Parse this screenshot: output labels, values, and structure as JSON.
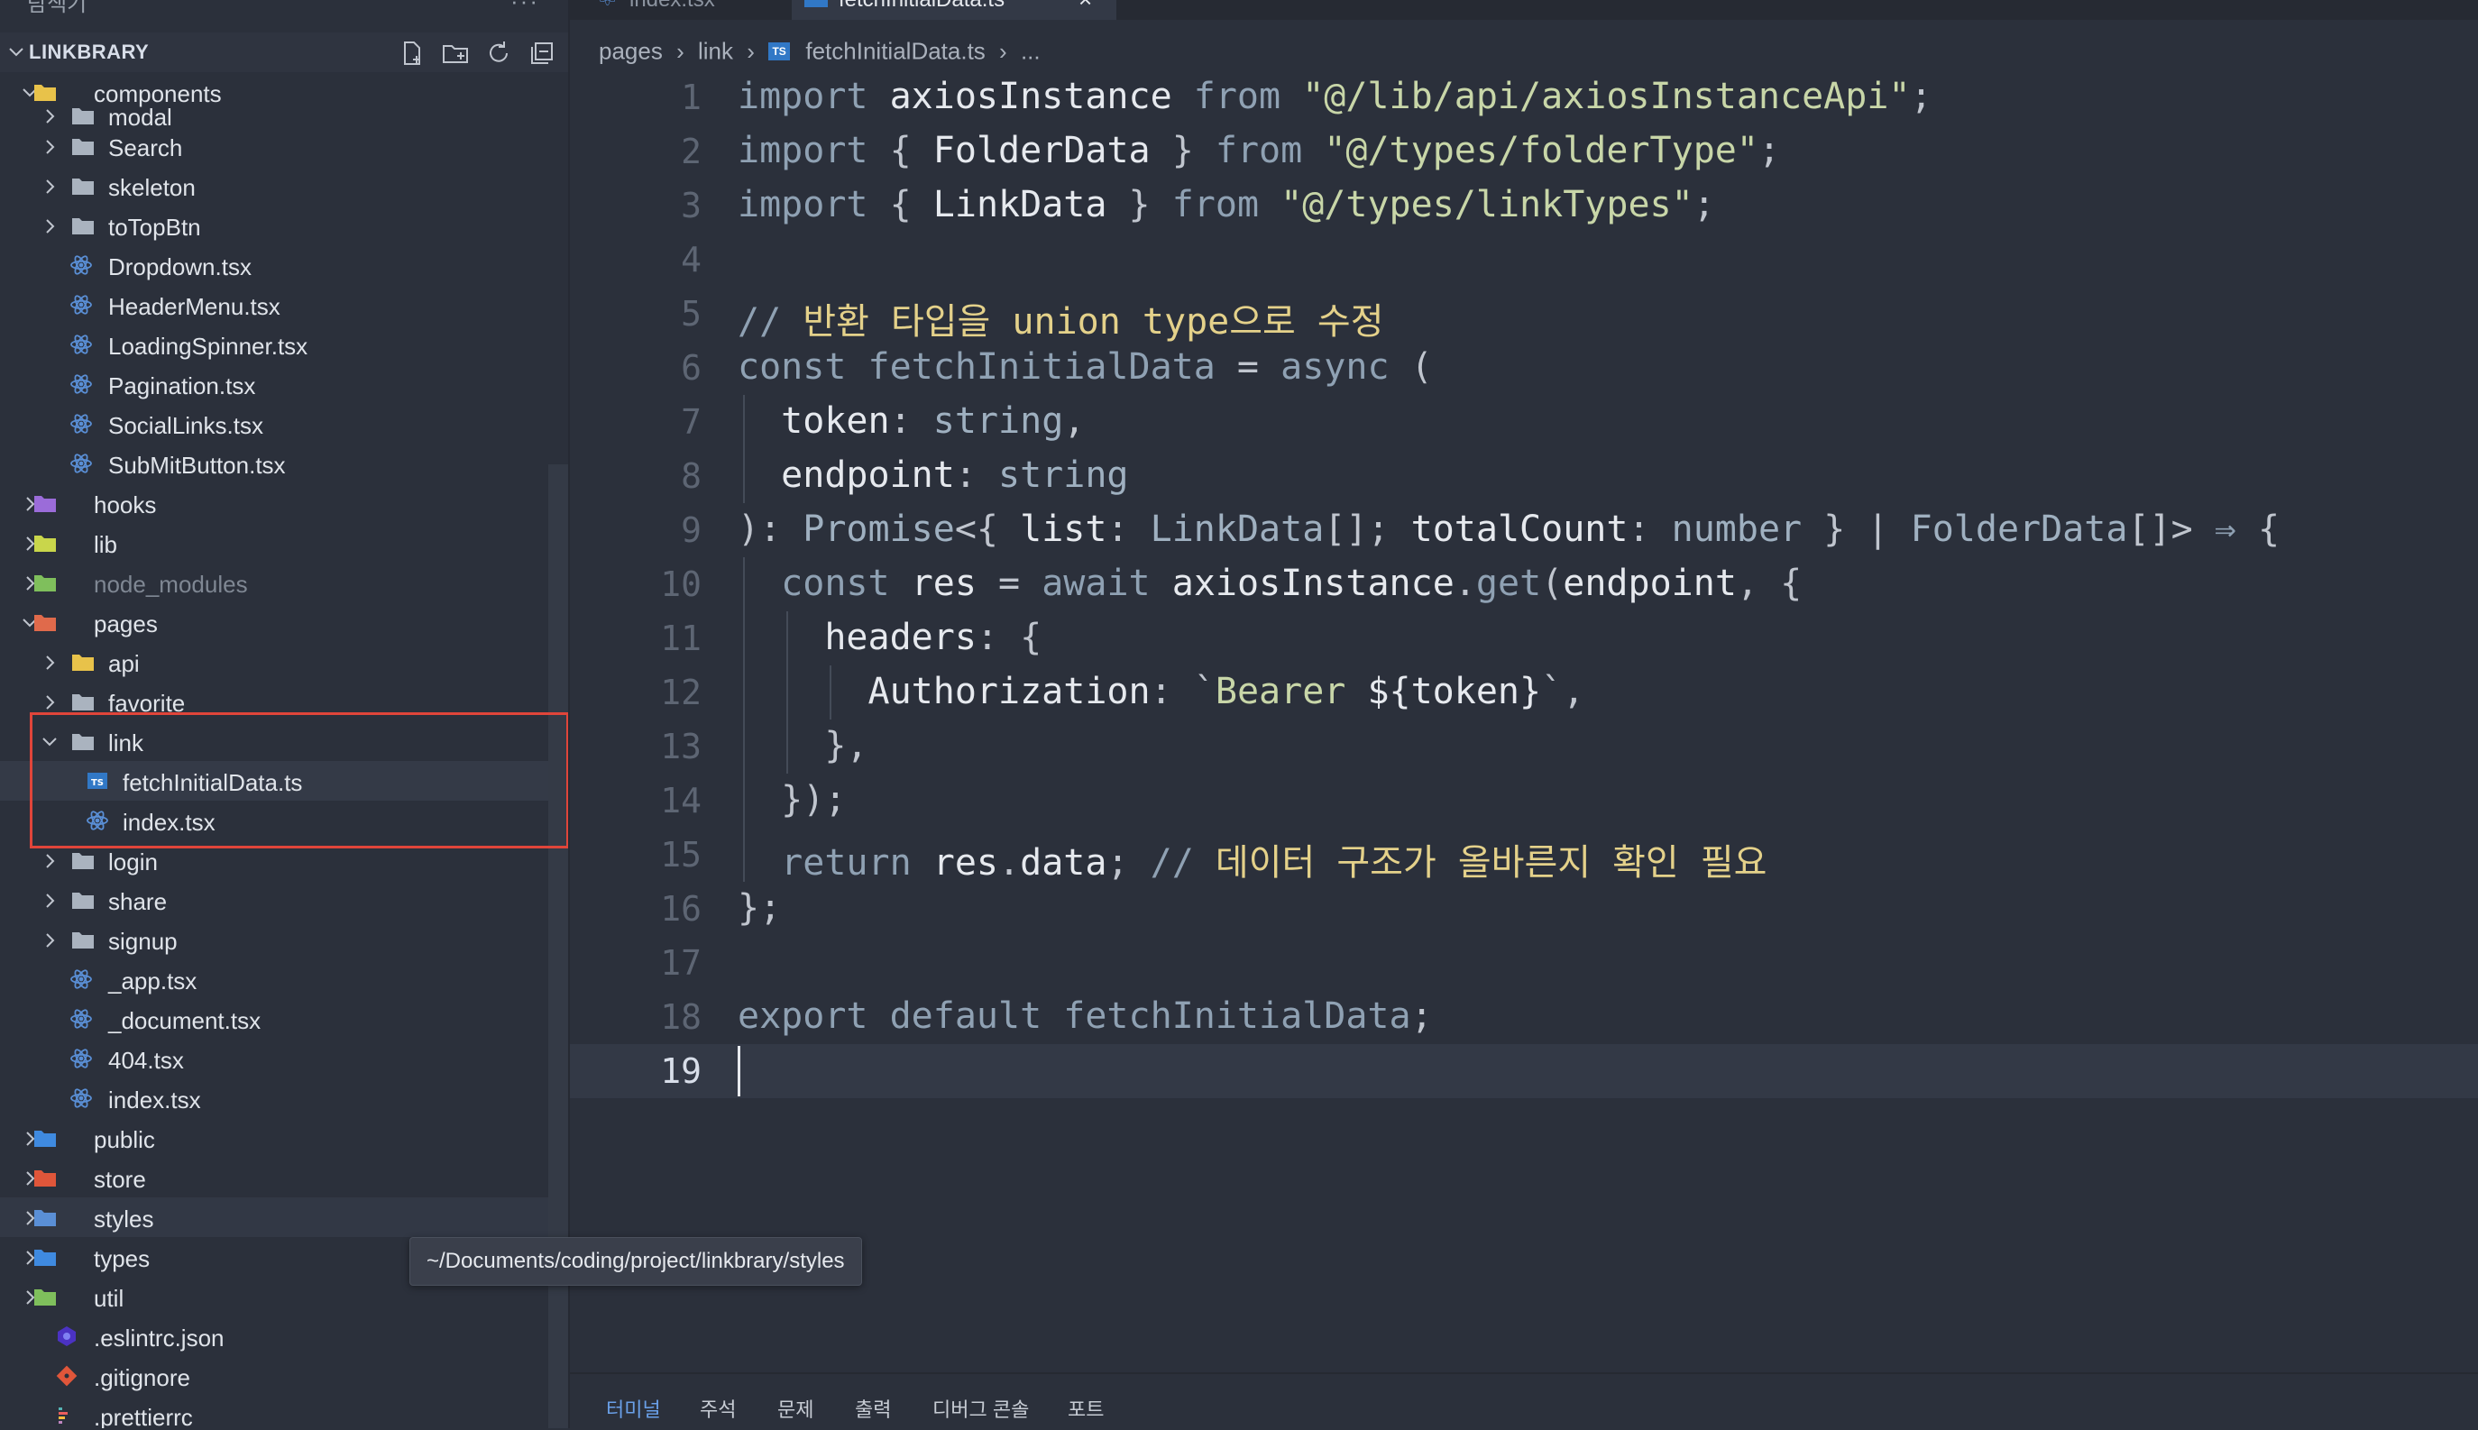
{
  "sidebar": {
    "top_title_cut": "탐색기",
    "project": "LINKBRARY",
    "tree": [
      {
        "label": "components",
        "type": "folder-open",
        "level": 0
      },
      {
        "label": "modal",
        "type": "folder",
        "level": 1
      },
      {
        "label": "Search",
        "type": "folder",
        "level": 1
      },
      {
        "label": "skeleton",
        "type": "folder",
        "level": 1
      },
      {
        "label": "toTopBtn",
        "type": "folder",
        "level": 1
      },
      {
        "label": "Dropdown.tsx",
        "type": "react",
        "level": 1
      },
      {
        "label": "HeaderMenu.tsx",
        "type": "react",
        "level": 1
      },
      {
        "label": "LoadingSpinner.tsx",
        "type": "react",
        "level": 1
      },
      {
        "label": "Pagination.tsx",
        "type": "react",
        "level": 1
      },
      {
        "label": "SocialLinks.tsx",
        "type": "react",
        "level": 1
      },
      {
        "label": "SubMitButton.tsx",
        "type": "react",
        "level": 1
      },
      {
        "label": "hooks",
        "type": "folder",
        "level": 0
      },
      {
        "label": "lib",
        "type": "folder",
        "level": 0
      },
      {
        "label": "node_modules",
        "type": "folder",
        "level": 0
      },
      {
        "label": "pages",
        "type": "folder-open",
        "level": 0
      },
      {
        "label": "api",
        "type": "folder",
        "level": 1
      },
      {
        "label": "favorite",
        "type": "folder",
        "level": 1
      },
      {
        "label": "link",
        "type": "folder-open",
        "level": 1
      },
      {
        "label": "fetchInitialData.ts",
        "type": "ts",
        "level": 2
      },
      {
        "label": "index.tsx",
        "type": "react",
        "level": 2
      },
      {
        "label": "login",
        "type": "folder",
        "level": 1
      },
      {
        "label": "share",
        "type": "folder",
        "level": 1
      },
      {
        "label": "signup",
        "type": "folder",
        "level": 1
      },
      {
        "label": "_app.tsx",
        "type": "react",
        "level": 1
      },
      {
        "label": "_document.tsx",
        "type": "react",
        "level": 1
      },
      {
        "label": "404.tsx",
        "type": "react",
        "level": 1
      },
      {
        "label": "index.tsx",
        "type": "react",
        "level": 1
      },
      {
        "label": "public",
        "type": "folder",
        "level": 0
      },
      {
        "label": "store",
        "type": "folder",
        "level": 0
      },
      {
        "label": "styles",
        "type": "folder",
        "level": 0
      },
      {
        "label": "types",
        "type": "folder",
        "level": 0
      },
      {
        "label": "util",
        "type": "folder",
        "level": 0
      },
      {
        "label": ".eslintrc.json",
        "type": "eslint",
        "level": 0
      },
      {
        "label": ".gitignore",
        "type": "git",
        "level": 0
      },
      {
        "label": ".prettierrc",
        "type": "prettier",
        "level": 0
      }
    ],
    "tooltip": "~/Documents/coding/project/linkbrary/styles"
  },
  "tabs": [
    {
      "label": "index.tsx"
    },
    {
      "label": "fetchInitialData.ts"
    }
  ],
  "breadcrumb": [
    "pages",
    "link",
    "fetchInitialData.ts",
    "..."
  ],
  "editor": {
    "current_line": 19,
    "line_numbers": [
      "1",
      "2",
      "3",
      "4",
      "5",
      "6",
      "7",
      "8",
      "9",
      "10",
      "11",
      "12",
      "13",
      "14",
      "15",
      "16",
      "17",
      "18",
      "19"
    ]
  },
  "panel_tabs": [
    "터미널",
    "주석",
    "문제",
    "출력",
    "디버그 콘솔",
    "포트"
  ],
  "colors": {
    "background": "#2b303b",
    "highlight_box": "#e0453a",
    "string": "#c8d6a8",
    "keyword": "#8fa1b3",
    "comment_korean": "#e4d18a"
  }
}
